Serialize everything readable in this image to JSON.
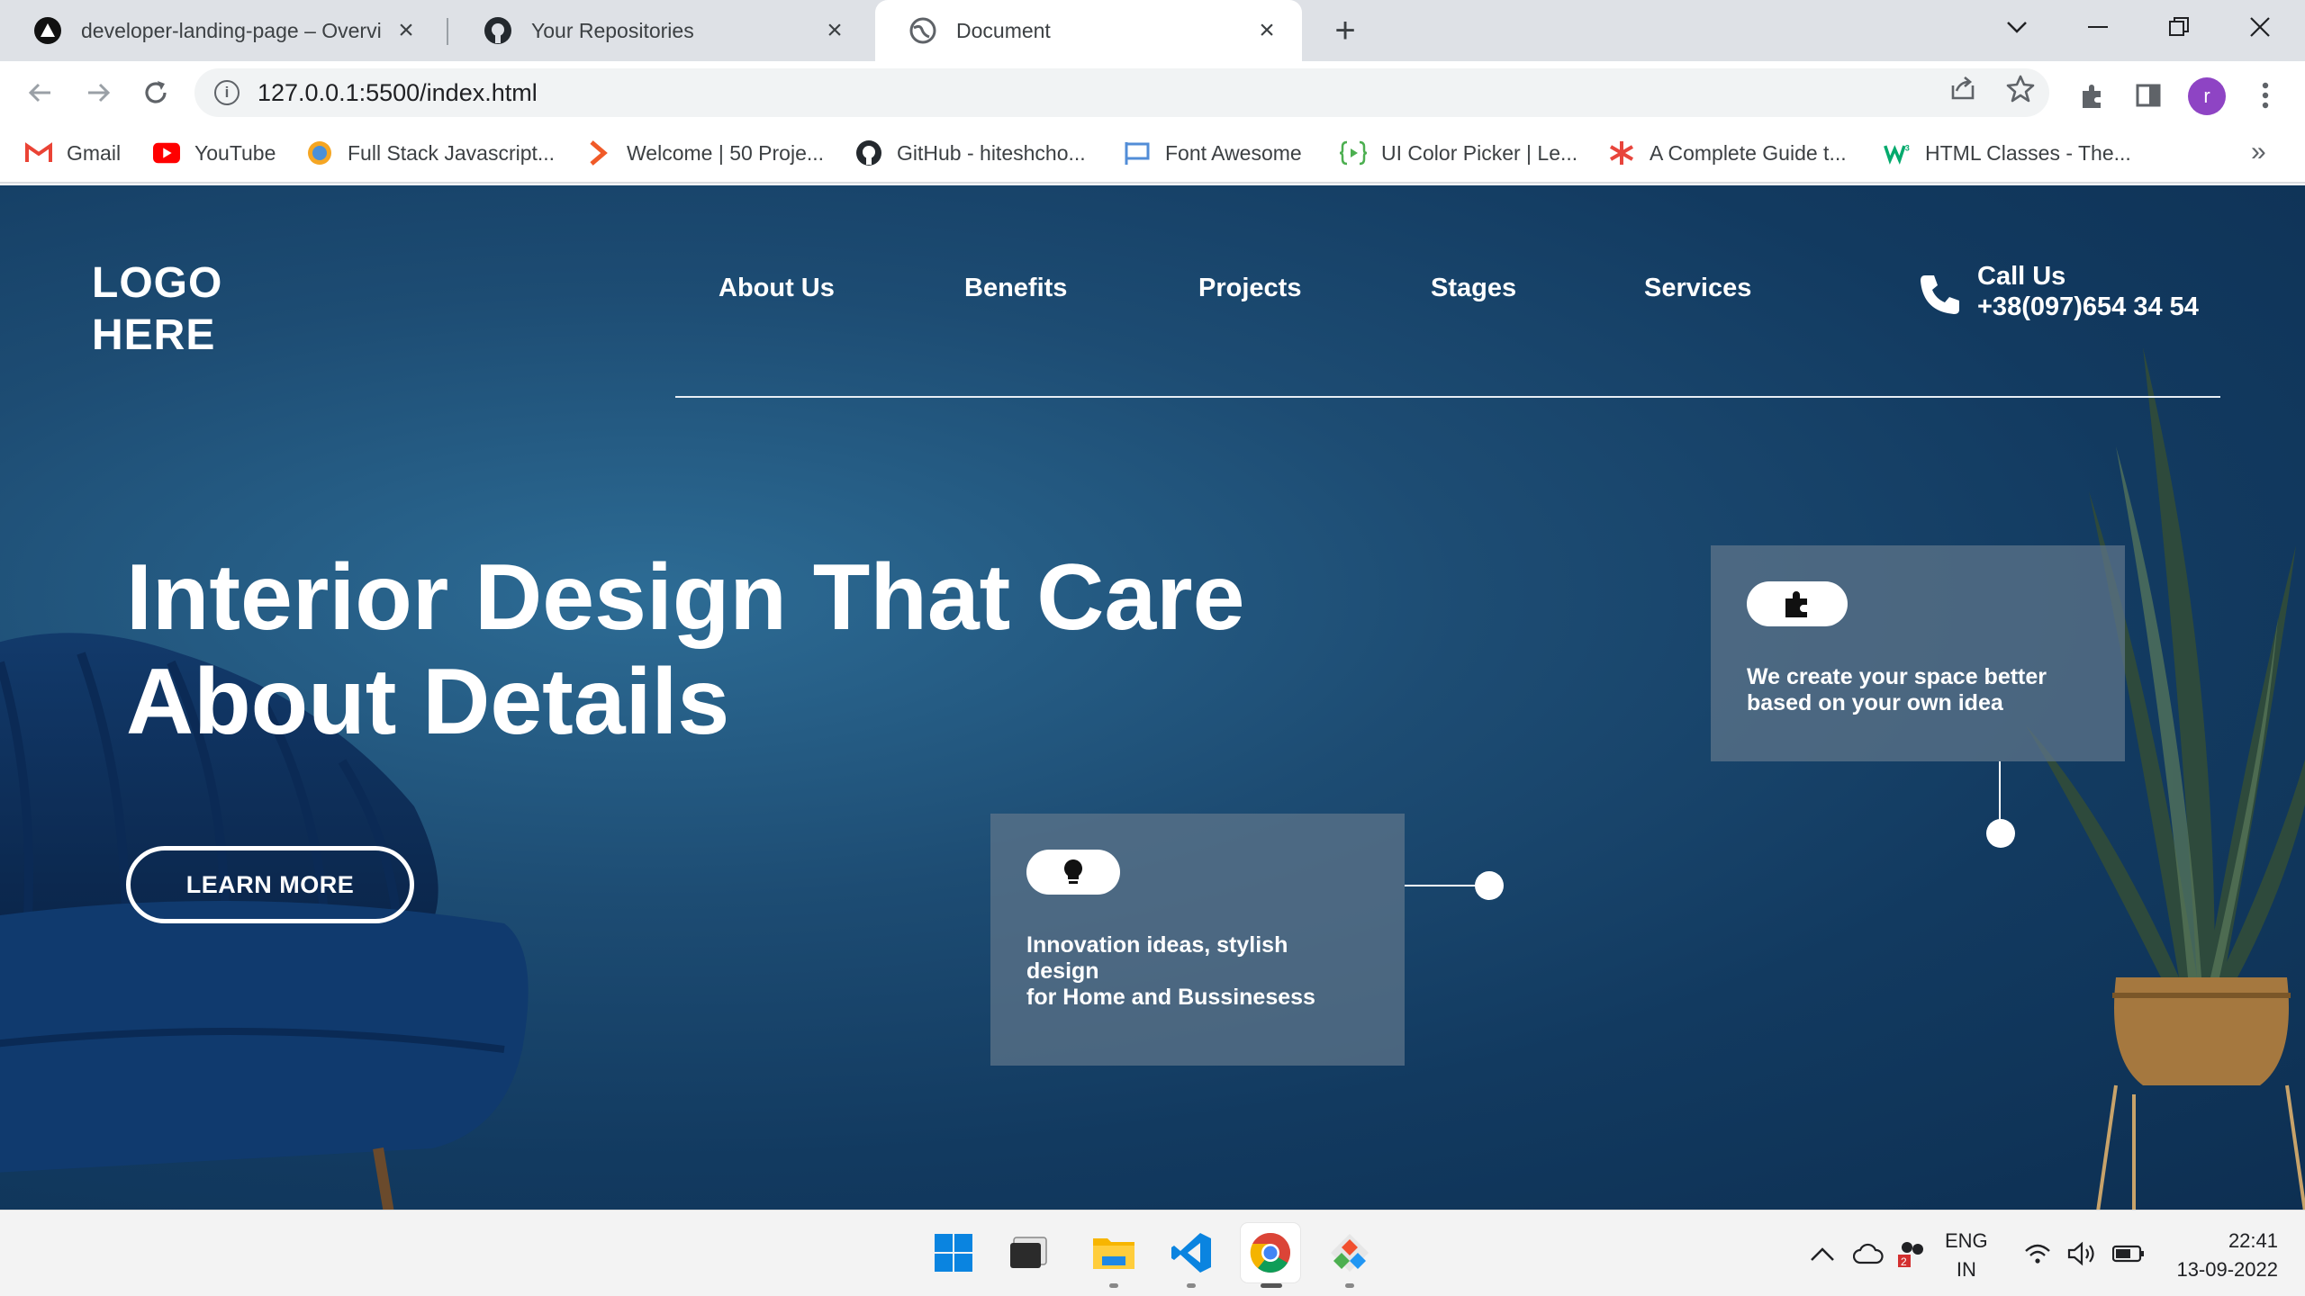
{
  "browser": {
    "tabs": [
      {
        "title": "developer-landing-page – Overvi",
        "icon": "vercel-icon"
      },
      {
        "title": "Your Repositories",
        "icon": "github-icon"
      },
      {
        "title": "Document",
        "icon": "globe-icon",
        "active": true
      }
    ],
    "url": "127.0.0.1:5500/index.html",
    "profile_initial": "r",
    "bookmarks": [
      {
        "label": "Gmail",
        "icon": "gmail-icon"
      },
      {
        "label": "YouTube",
        "icon": "youtube-icon"
      },
      {
        "label": "Full Stack Javascript...",
        "icon": "course-icon"
      },
      {
        "label": "Welcome | 50 Proje...",
        "icon": "chevron-right-icon"
      },
      {
        "label": "GitHub - hiteshcho...",
        "icon": "github-icon"
      },
      {
        "label": "Font Awesome",
        "icon": "flag-icon"
      },
      {
        "label": "UI Color Picker | Le...",
        "icon": "color-picker-icon"
      },
      {
        "label": "A Complete Guide t...",
        "icon": "asterisk-icon"
      },
      {
        "label": "HTML Classes - The...",
        "icon": "w3schools-icon"
      }
    ]
  },
  "page": {
    "logo": {
      "line1": "LOGO",
      "line2": "HERE"
    },
    "nav": [
      "About Us",
      "Benefits",
      "Projects",
      "Stages",
      "Services"
    ],
    "call": {
      "label": "Call Us",
      "number": "+38(097)654 34 54"
    },
    "hero": {
      "line1": "Interior Design That Care",
      "line2": "About Details"
    },
    "cta": "LEARN MORE",
    "cards": [
      {
        "icon": "lightbulb-icon",
        "lines": [
          "Innovation ideas, stylish",
          "design",
          "for Home and Bussinesess"
        ]
      },
      {
        "icon": "puzzle-icon",
        "lines": [
          "We create your space better",
          "based on your own idea"
        ]
      }
    ]
  },
  "taskbar": {
    "apps": [
      "windows-start-icon",
      "terminal-icon",
      "file-explorer-icon",
      "vscode-icon",
      "chrome-icon",
      "git-icon"
    ],
    "lang": {
      "line1": "ENG",
      "line2": "IN"
    },
    "time": "22:41",
    "date": "13-09-2022"
  },
  "colors": {
    "hero_bg": "#1d4c73",
    "card_bg": "#5f768a",
    "accent_white": "#ffffff"
  }
}
